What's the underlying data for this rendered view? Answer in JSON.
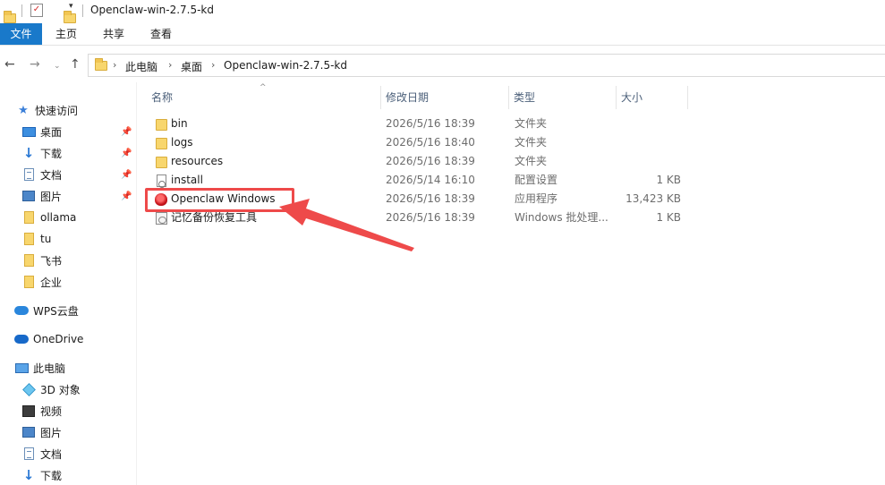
{
  "window": {
    "title": "Openclaw-win-2.7.5-kd"
  },
  "ribbon": {
    "file_tab": "文件",
    "tabs": [
      "主页",
      "共享",
      "查看"
    ]
  },
  "address": {
    "breadcrumbs": [
      "此电脑",
      "桌面",
      "Openclaw-win-2.7.5-kd"
    ]
  },
  "sidebar": {
    "quick_access": "快速访问",
    "quick_items": [
      {
        "label": "桌面",
        "icon": "desktop-icon",
        "pinned": true
      },
      {
        "label": "下载",
        "icon": "download-icon",
        "pinned": true
      },
      {
        "label": "文档",
        "icon": "document-icon",
        "pinned": true
      },
      {
        "label": "图片",
        "icon": "pictures-icon",
        "pinned": true
      },
      {
        "label": "ollama",
        "icon": "folder-icon",
        "pinned": false
      },
      {
        "label": "tu",
        "icon": "folder-icon",
        "pinned": false
      },
      {
        "label": "飞书",
        "icon": "folder-icon",
        "pinned": false
      },
      {
        "label": "企业",
        "icon": "folder-icon",
        "pinned": false
      }
    ],
    "wps": "WPS云盘",
    "onedrive": "OneDrive",
    "this_pc": "此电脑",
    "pc_items": [
      {
        "label": "3D 对象",
        "icon": "3d-objects-icon"
      },
      {
        "label": "视频",
        "icon": "video-icon"
      },
      {
        "label": "图片",
        "icon": "pictures-icon"
      },
      {
        "label": "文档",
        "icon": "document-icon"
      },
      {
        "label": "下载",
        "icon": "download-icon"
      }
    ]
  },
  "columns": {
    "name": "名称",
    "date": "修改日期",
    "type": "类型",
    "size": "大小"
  },
  "files": [
    {
      "name": "bin",
      "date": "2026/5/16 18:39",
      "type": "文件夹",
      "size": "",
      "icon": "folder-icon"
    },
    {
      "name": "logs",
      "date": "2026/5/16 18:40",
      "type": "文件夹",
      "size": "",
      "icon": "folder-icon"
    },
    {
      "name": "resources",
      "date": "2026/5/16 18:39",
      "type": "文件夹",
      "size": "",
      "icon": "folder-icon"
    },
    {
      "name": "install",
      "date": "2026/5/14 16:10",
      "type": "配置设置",
      "size": "1 KB",
      "icon": "config-file-icon"
    },
    {
      "name": "Openclaw Windows",
      "date": "2026/5/16 18:39",
      "type": "应用程序",
      "size": "13,423 KB",
      "icon": "app-icon"
    },
    {
      "name": "记忆备份恢复工具",
      "date": "2026/5/16 18:39",
      "type": "Windows 批处理...",
      "size": "1 KB",
      "icon": "batch-file-icon"
    }
  ],
  "colors": {
    "accent": "#1979ca",
    "annotation": "#ee4a4a"
  }
}
